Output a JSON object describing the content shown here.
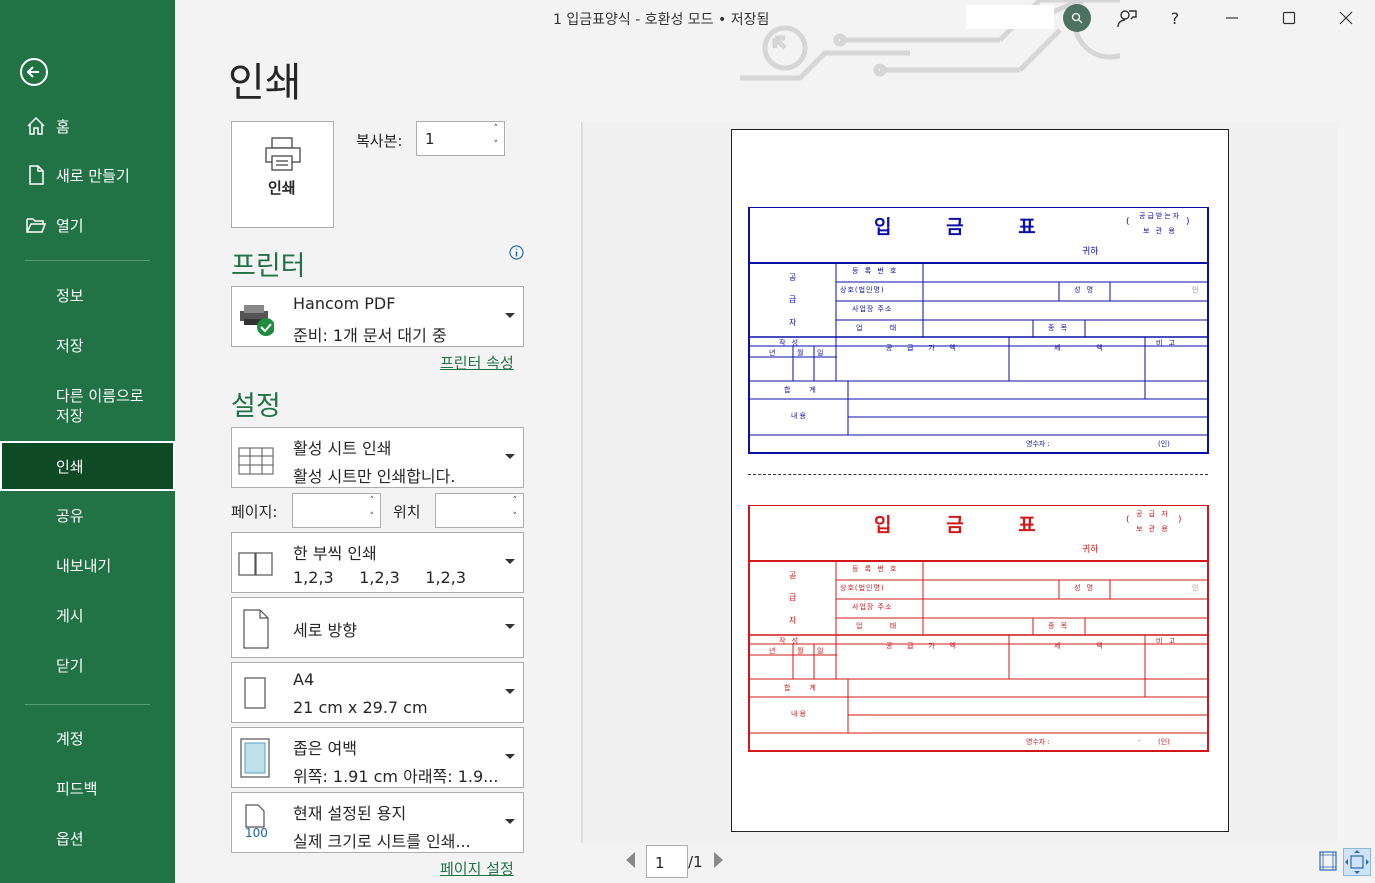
{
  "window": {
    "title": "1 입금표양식  -  호환성 모드 • 저장됨",
    "help_label": "?",
    "minimize_icon": "minimize-icon",
    "maximize_icon": "maximize-icon",
    "close_icon": "close-icon"
  },
  "sidebar": {
    "bg_color": "#217346",
    "items": [
      {
        "label": "홈",
        "icon": "home-icon"
      },
      {
        "label": "새로 만들기",
        "icon": "new-file-icon"
      },
      {
        "label": "열기",
        "icon": "folder-open-icon"
      },
      {
        "label": "정보"
      },
      {
        "label": "저장"
      },
      {
        "label": "다른 이름으로\n저장"
      },
      {
        "label": "인쇄"
      },
      {
        "label": "공유"
      },
      {
        "label": "내보내기"
      },
      {
        "label": "게시"
      },
      {
        "label": "닫기"
      },
      {
        "label": "계정"
      },
      {
        "label": "피드백"
      },
      {
        "label": "옵션"
      }
    ],
    "save_as_line1": "다른 이름으로",
    "save_as_line2": "저장",
    "active": "인쇄"
  },
  "print": {
    "page_title": "인쇄",
    "print_button_label": "인쇄",
    "copies_label": "복사본:",
    "copies_value": "1",
    "printer_heading": "프린터",
    "printer_name": "Hancom PDF",
    "printer_status": "준비: 1개 문서 대기 중",
    "printer_properties_link": "프린터 속성",
    "settings_heading": "설정",
    "settings": [
      {
        "line1": "활성 시트 인쇄",
        "line2": "활성 시트만 인쇄합니다.",
        "icon": "sheet-grid-icon"
      },
      {
        "line1": "한 부씩 인쇄",
        "line2": "1,2,3     1,2,3     1,2,3",
        "icon": "collate-icon"
      },
      {
        "line1": "세로 방향",
        "line2": "",
        "icon": "portrait-icon"
      },
      {
        "line1": "A4",
        "line2": "21 cm x 29.7 cm",
        "icon": "paper-size-icon"
      },
      {
        "line1": "좁은 여백",
        "line2": "위쪽: 1.91 cm 아래쪽: 1.9...",
        "icon": "margins-icon"
      },
      {
        "line1": "현재 설정된 용지",
        "line2": "실제 크기로 시트를 인쇄...",
        "icon": "scaling-icon",
        "icon_text": "100"
      }
    ],
    "pages_label": "페이지:",
    "pages_to_label": "위치",
    "pages_from_value": "",
    "pages_to_value": "",
    "page_setup_link": "페이지 설정",
    "accent_color": "#217346"
  },
  "preview": {
    "current_page": "1",
    "total_pages": "/1",
    "form_blue": {
      "title": "입 금 표",
      "copy_note_line1": "공급받는자",
      "copy_note_line2": "보 관 용",
      "paren_left": "(",
      "paren_right": ")",
      "honorific": "귀하",
      "supplier_1": "공",
      "supplier_2": "급",
      "supplier_3": "자",
      "reg_no": "등 록 번 호",
      "company": "상호(법인명)",
      "name": "성 명",
      "seal": "인",
      "address": "사업장 주소",
      "business_type": "업      태",
      "business_item": "종 목",
      "written": "작 성",
      "year": "년",
      "month": "월",
      "day": "일",
      "supply_amount": "공   급   가   액",
      "tax": "세        액",
      "remarks": "비 고",
      "total": "합    계",
      "content": "내용",
      "receiver": "영수자 :",
      "receiver_seal": "(인)",
      "color": "#0a10a8"
    },
    "form_red": {
      "title": "입 금 표",
      "copy_note_line1": "공 급 자",
      "copy_note_line2": "보 관 용",
      "paren_left": "(",
      "paren_right": ")",
      "honorific": "귀하",
      "supplier_1": "공",
      "supplier_2": "급",
      "supplier_3": "자",
      "reg_no": "등 록 번 호",
      "company": "상호(법인명)",
      "name": "성 명",
      "seal": "인",
      "address": "사업장 주소",
      "business_type": "업      태",
      "business_item": "종 목",
      "written": "작 성",
      "year": "년",
      "month": "월",
      "day": "일",
      "supply_amount": "공   급   가   액",
      "tax": "세        액",
      "remarks": "비 고",
      "total": "합    계",
      "content": "내용",
      "receiver": "영수자 :",
      "receiver_dash": "-",
      "receiver_seal": "(인)",
      "color": "#d01818"
    }
  }
}
